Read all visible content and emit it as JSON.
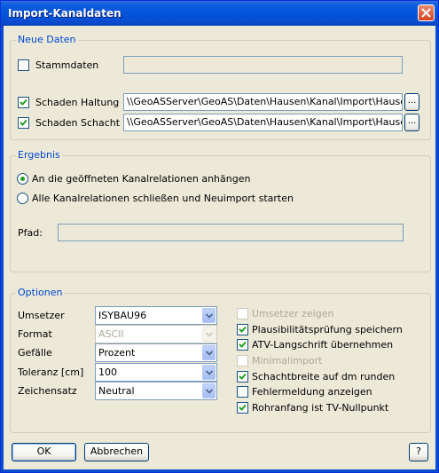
{
  "window": {
    "title": "Import-Kanaldaten"
  },
  "neue_daten": {
    "legend": "Neue Daten",
    "stammdaten": {
      "label": "Stammdaten",
      "checked": false,
      "path": ""
    },
    "schaden_haltung": {
      "label": "Schaden Haltung",
      "checked": true,
      "path": "\\\\GeoASServer\\GeoAS\\Daten\\Hausen\\Kanal\\Import\\Hausen.H"
    },
    "schaden_schacht": {
      "label": "Schaden Schacht",
      "checked": true,
      "path": "\\\\GeoASServer\\GeoAS\\Daten\\Hausen\\Kanal\\Import\\Hausen.S"
    },
    "browse_label": "..."
  },
  "ergebnis": {
    "legend": "Ergebnis",
    "option_append": "An die geöffneten Kanalrelationen anhängen",
    "option_new": "Alle Kanalrelationen schließen und Neuimport starten",
    "selected": "append",
    "pfad_label": "Pfad:",
    "pfad_value": ""
  },
  "optionen": {
    "legend": "Optionen",
    "umsetzer": {
      "label": "Umsetzer",
      "value": "ISYBAU96"
    },
    "format": {
      "label": "Format",
      "value": "ASCII"
    },
    "gefaelle": {
      "label": "Gefälle",
      "value": "Prozent"
    },
    "toleranz": {
      "label": "Toleranz [cm]",
      "value": "100"
    },
    "zeichensatz": {
      "label": "Zeichensatz",
      "value": "Neutral"
    },
    "checks": [
      {
        "label": "Umsetzer zeigen",
        "checked": false,
        "enabled": false
      },
      {
        "label": "Plausibilitätsprüfung speichern",
        "checked": true,
        "enabled": true
      },
      {
        "label": "ATV-Langschrift übernehmen",
        "checked": true,
        "enabled": true
      },
      {
        "label": "Minimalimport",
        "checked": false,
        "enabled": false
      },
      {
        "label": "Schachtbreite auf dm runden",
        "checked": true,
        "enabled": true
      },
      {
        "label": "Fehlermeldung anzeigen",
        "checked": false,
        "enabled": true
      },
      {
        "label": "Rohranfang ist TV-Nullpunkt",
        "checked": true,
        "enabled": true
      }
    ]
  },
  "buttons": {
    "ok": "OK",
    "cancel": "Abbrechen",
    "help": "?"
  },
  "icons": {
    "close": "close-icon",
    "check": "checkmark-icon",
    "dropdown": "chevron-down-icon"
  },
  "colors": {
    "title_bar": "#0A4ECF",
    "group_legend": "#0046D5",
    "checkmark": "#21A121",
    "dialog_bg": "#ECE9D8"
  }
}
